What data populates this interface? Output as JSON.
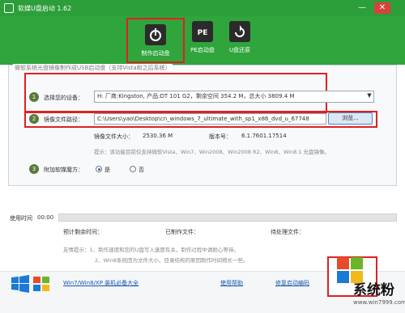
{
  "window": {
    "title": "软媒U盘启动 1.62"
  },
  "toolbar": {
    "items": [
      {
        "label": "制作启动盘",
        "icon": "usb-drive-icon",
        "active": true
      },
      {
        "label": "PE启动盘",
        "icon": "pe-drive-icon",
        "active": false
      },
      {
        "label": "U盘还原",
        "icon": "usb-restore-icon",
        "active": false
      }
    ]
  },
  "form": {
    "group_title": "微软系统光盘镜像制作成USB启动盘（支持Vista和之后系统）",
    "step1_num": "1",
    "device_label": "选择您的设备：",
    "device_value": "H: 厂商:Kingston, 产品:DT 101 G2，剩余空间 354.2 M，总大小 3809.4 M",
    "step2_num": "2",
    "image_label": "镜像文件路径：",
    "image_path": "C:\\Users\\yao\\Desktop\\cn_windows_7_ultimate_with_sp1_x86_dvd_u_67748",
    "browse_label": "浏览...",
    "size_label": "镜像文件大小：",
    "size_value": "2530.36 M",
    "version_label": "版本号：",
    "version_value": "6.1.7601.17514",
    "hint": "提示：该功能目前仅支持微软Vista、Win7、Win2008、Win2008 R2、Win8、Win8.1 光盘镜像。",
    "step3_num": "3",
    "magic_label": "附加软媒魔方：",
    "magic_yes": "是",
    "magic_no": "否"
  },
  "progress": {
    "elapsed_label": "使用时间",
    "elapsed_value": "00:00",
    "remaining_label": "预计剩余时间：",
    "processed_label": "已制作文件：",
    "pending_label": "待处理文件："
  },
  "tips": {
    "line1": "友情提示：1、制作速度和您的U盘写入速度有关，制作过程中请耐心等待。",
    "line2": "2、Win8系统因为文件大小、目录结构的原因制作时间稍长一些。"
  },
  "footer": {
    "win_link": "Win7/Win8/XP 装机必备大全",
    "help_link": "使用帮助",
    "fix_link": "修复启动编码"
  },
  "watermark": {
    "text": "系统粉",
    "url": "www.win7999.com"
  }
}
